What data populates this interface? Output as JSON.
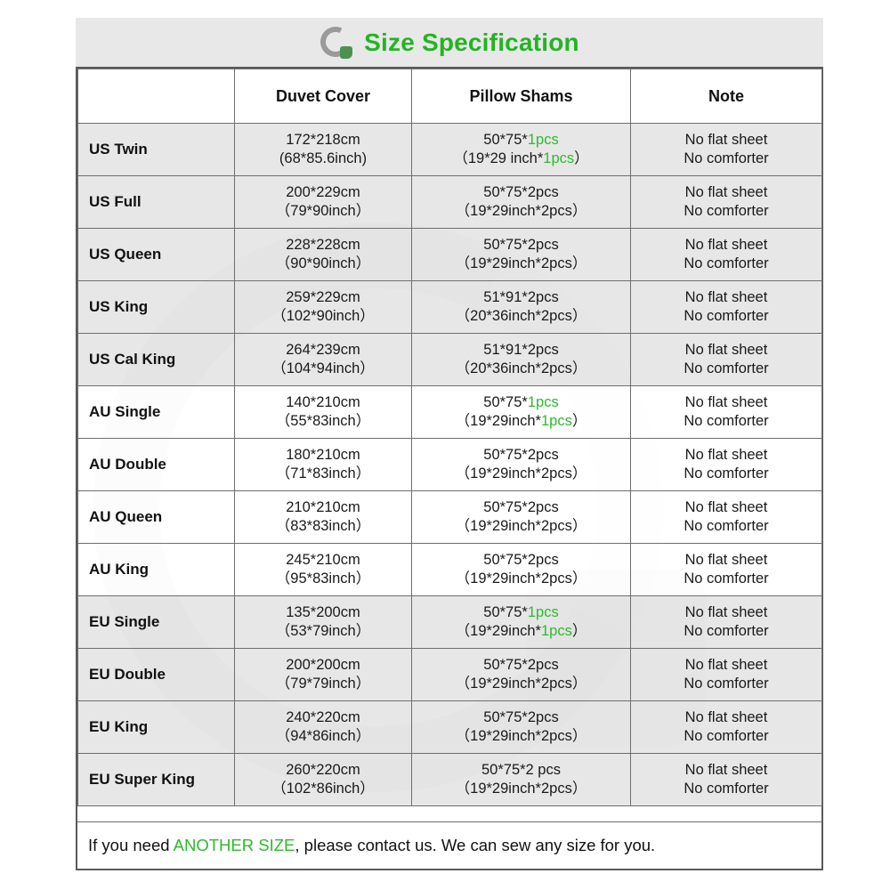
{
  "header": {
    "title": "Size Specification",
    "logo_icon": "circular-arc-logo-icon",
    "title_color": "#22b522"
  },
  "table": {
    "columns": [
      "",
      "Duvet Cover",
      "Pillow Shams",
      "Note"
    ],
    "rows": [
      {
        "name": "US Twin",
        "shade": "gray",
        "duvet_cm": "172*218cm",
        "duvet_in": "(68*85.6inch)",
        "sham_cm_pre": "50*75*",
        "sham_cm_qty": "1pcs",
        "sham_cm_qty_green": true,
        "sham_in_pre": "（19*29 inch*",
        "sham_in_qty": "1pcs",
        "sham_in_post": "）",
        "sham_in_qty_green": true,
        "note1": "No flat sheet",
        "note2": "No comforter"
      },
      {
        "name": "US Full",
        "shade": "gray",
        "duvet_cm": "200*229cm",
        "duvet_in": "（79*90inch）",
        "sham_cm_pre": "50*75*",
        "sham_cm_qty": "2pcs",
        "sham_cm_qty_green": false,
        "sham_in_pre": "（19*29inch*",
        "sham_in_qty": "2pcs",
        "sham_in_post": "）",
        "sham_in_qty_green": false,
        "note1": "No flat sheet",
        "note2": "No comforter"
      },
      {
        "name": "US Queen",
        "shade": "gray",
        "duvet_cm": "228*228cm",
        "duvet_in": "（90*90inch）",
        "sham_cm_pre": "50*75*",
        "sham_cm_qty": "2pcs",
        "sham_cm_qty_green": false,
        "sham_in_pre": "（19*29inch*",
        "sham_in_qty": "2pcs",
        "sham_in_post": "）",
        "sham_in_qty_green": false,
        "note1": "No flat sheet",
        "note2": "No comforter"
      },
      {
        "name": "US King",
        "shade": "gray",
        "duvet_cm": "259*229cm",
        "duvet_in": "（102*90inch）",
        "sham_cm_pre": "51*91*",
        "sham_cm_qty": "2pcs",
        "sham_cm_qty_green": false,
        "sham_in_pre": "（20*36inch*",
        "sham_in_qty": "2pcs",
        "sham_in_post": "）",
        "sham_in_qty_green": false,
        "note1": "No flat sheet",
        "note2": "No comforter"
      },
      {
        "name": "US Cal King",
        "shade": "gray",
        "duvet_cm": "264*239cm",
        "duvet_in": "（104*94inch）",
        "sham_cm_pre": "51*91*",
        "sham_cm_qty": "2pcs",
        "sham_cm_qty_green": false,
        "sham_in_pre": "（20*36inch*",
        "sham_in_qty": "2pcs",
        "sham_in_post": "）",
        "sham_in_qty_green": false,
        "note1": "No flat sheet",
        "note2": "No comforter"
      },
      {
        "name": "AU Single",
        "shade": "white",
        "duvet_cm": "140*210cm",
        "duvet_in": "（55*83inch）",
        "sham_cm_pre": "50*75*",
        "sham_cm_qty": "1pcs",
        "sham_cm_qty_green": true,
        "sham_in_pre": "（19*29inch*",
        "sham_in_qty": "1pcs",
        "sham_in_post": "）",
        "sham_in_qty_green": true,
        "note1": "No flat sheet",
        "note2": "No comforter"
      },
      {
        "name": "AU Double",
        "shade": "white",
        "duvet_cm": "180*210cm",
        "duvet_in": "（71*83inch）",
        "sham_cm_pre": "50*75*",
        "sham_cm_qty": "2pcs",
        "sham_cm_qty_green": false,
        "sham_in_pre": "（19*29inch*",
        "sham_in_qty": "2pcs",
        "sham_in_post": "）",
        "sham_in_qty_green": false,
        "note1": "No flat sheet",
        "note2": "No comforter"
      },
      {
        "name": "AU Queen",
        "shade": "white",
        "duvet_cm": "210*210cm",
        "duvet_in": "（83*83inch）",
        "sham_cm_pre": "50*75*",
        "sham_cm_qty": "2pcs",
        "sham_cm_qty_green": false,
        "sham_in_pre": "（19*29inch*",
        "sham_in_qty": "2pcs",
        "sham_in_post": "）",
        "sham_in_qty_green": false,
        "note1": "No flat sheet",
        "note2": "No comforter"
      },
      {
        "name": "AU King",
        "shade": "white",
        "duvet_cm": "245*210cm",
        "duvet_in": "（95*83inch）",
        "sham_cm_pre": "50*75*",
        "sham_cm_qty": "2pcs",
        "sham_cm_qty_green": false,
        "sham_in_pre": "（19*29inch*",
        "sham_in_qty": "2pcs",
        "sham_in_post": "）",
        "sham_in_qty_green": false,
        "note1": "No flat sheet",
        "note2": "No comforter"
      },
      {
        "name": "EU Single",
        "shade": "gray",
        "duvet_cm": "135*200cm",
        "duvet_in": "（53*79inch）",
        "sham_cm_pre": "50*75*",
        "sham_cm_qty": "1pcs",
        "sham_cm_qty_green": true,
        "sham_in_pre": "（19*29inch*",
        "sham_in_qty": "1pcs",
        "sham_in_post": "）",
        "sham_in_qty_green": true,
        "note1": "No flat sheet",
        "note2": "No comforter"
      },
      {
        "name": "EU Double",
        "shade": "gray",
        "duvet_cm": "200*200cm",
        "duvet_in": "（79*79inch）",
        "sham_cm_pre": "50*75*",
        "sham_cm_qty": "2pcs",
        "sham_cm_qty_green": false,
        "sham_in_pre": "（19*29inch*",
        "sham_in_qty": "2pcs",
        "sham_in_post": "）",
        "sham_in_qty_green": false,
        "note1": "No flat sheet",
        "note2": "No comforter"
      },
      {
        "name": "EU King",
        "shade": "gray",
        "duvet_cm": "240*220cm",
        "duvet_in": "（94*86inch）",
        "sham_cm_pre": "50*75*",
        "sham_cm_qty": "2pcs",
        "sham_cm_qty_green": false,
        "sham_in_pre": "（19*29inch*",
        "sham_in_qty": "2pcs",
        "sham_in_post": "）",
        "sham_in_qty_green": false,
        "note1": "No flat sheet",
        "note2": "No comforter"
      },
      {
        "name": "EU Super King",
        "shade": "gray",
        "duvet_cm": "260*220cm",
        "duvet_in": "（102*86inch）",
        "sham_cm_pre": "50*75*2 pcs",
        "sham_cm_qty": "",
        "sham_cm_qty_green": false,
        "sham_in_pre": "（19*29inch*",
        "sham_in_qty": "2pcs",
        "sham_in_post": "）",
        "sham_in_qty_green": false,
        "note1": "No flat sheet",
        "note2": "No comforter"
      }
    ]
  },
  "footer": {
    "part1": "If you need ",
    "highlight": "ANOTHER SIZE",
    "part2": ", please contact us. We can sew any size for you.",
    "highlight_color": "#2cbb2c"
  }
}
